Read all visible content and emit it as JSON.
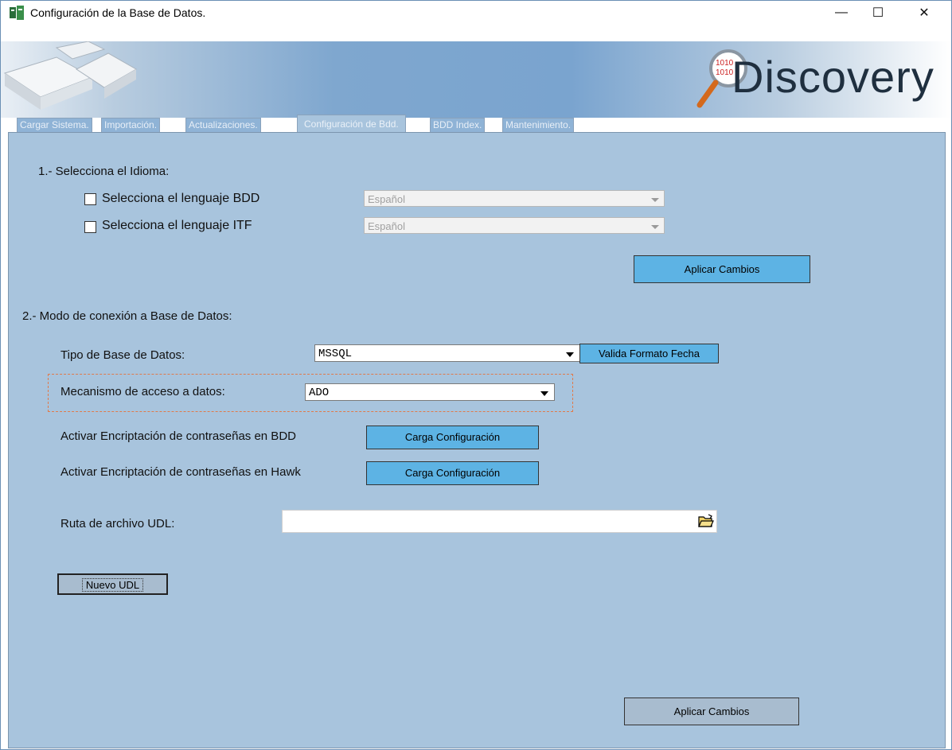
{
  "window": {
    "title": "Configuración de la Base de Datos.",
    "controls": {
      "minimize": "—",
      "maximize": "☐",
      "close": "✕"
    }
  },
  "banner": {
    "logo": "Discovery"
  },
  "tabs": [
    {
      "label": "Cargar Sistema."
    },
    {
      "label": "Importación."
    },
    {
      "label": "Actualizaciones."
    },
    {
      "label": "Configuración de Bdd."
    },
    {
      "label": "BDD Index."
    },
    {
      "label": "Mantenimiento."
    }
  ],
  "section1": {
    "heading": "1.- Selecciona el Idioma:",
    "bdd_label": "Selecciona el lenguaje BDD",
    "bdd_value": "Español",
    "itf_label": "Selecciona el lenguaje ITF",
    "itf_value": "Español",
    "apply_label": "Aplicar Cambios"
  },
  "section2": {
    "heading": "2.- Modo de conexión a Base de Datos:",
    "db_type_label": "Tipo de Base de Datos:",
    "db_type_value": "MSSQL",
    "validate_date_label": "Valida Formato Fecha",
    "access_label": "Mecanismo de acceso a datos:",
    "access_value": "ADO",
    "encrypt_bdd_label": "Activar Encriptación de contraseñas en BDD",
    "encrypt_bdd_button": "Carga Configuración",
    "encrypt_hawk_label": "Activar Encriptación de contraseñas en Hawk",
    "encrypt_hawk_button": "Carga Configuración",
    "udl_label": "Ruta de archivo UDL:",
    "udl_value": "",
    "new_udl_label": "Nuevo UDL",
    "apply_label": "Aplicar Cambios"
  },
  "colors": {
    "panel": "#a8c4dd",
    "button_blue": "#5db3e4",
    "highlight_border": "#e07a4a"
  }
}
